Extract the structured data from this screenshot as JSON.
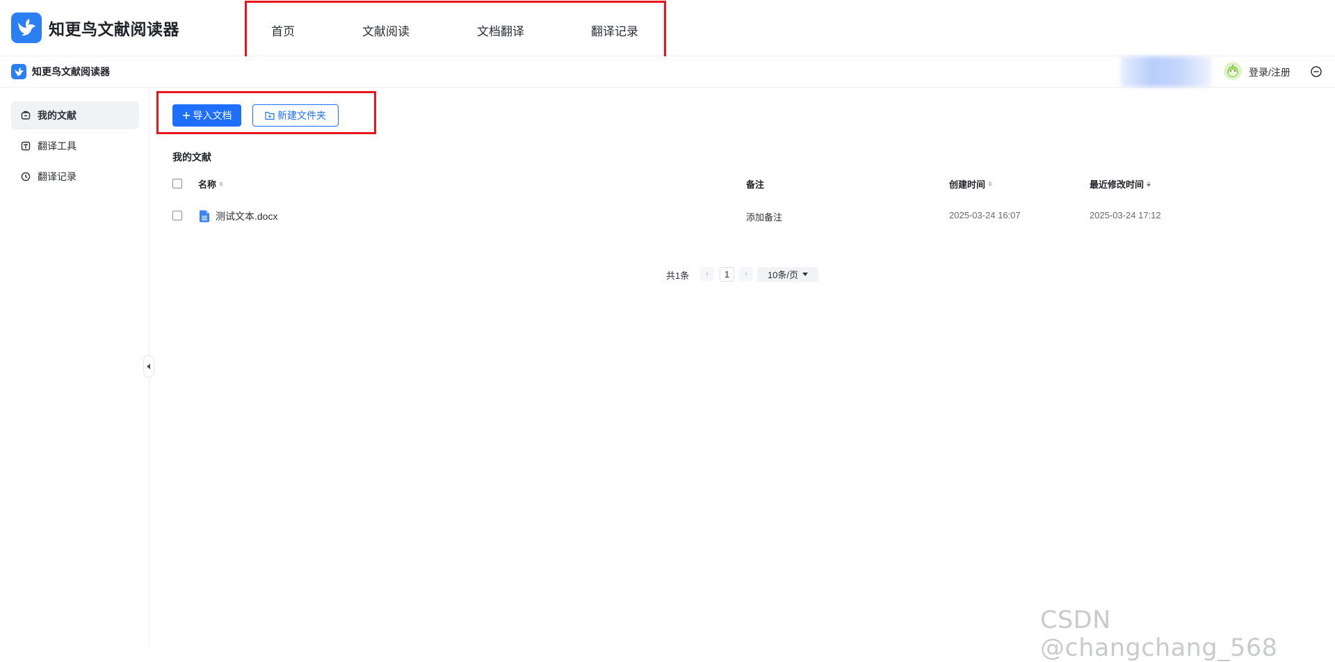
{
  "app": {
    "name": "知更鸟文献阅读器",
    "accent": "#1e6fff",
    "brand_color": "#2b7ff0",
    "highlight_color": "#e8161c"
  },
  "nav": {
    "items": [
      "首页",
      "文献阅读",
      "文档翻译",
      "翻译记录"
    ]
  },
  "subheader": {
    "title": "知更鸟文献阅读器",
    "login_label": "登录/注册"
  },
  "sidebar": {
    "items": [
      {
        "label": "我的文献",
        "icon": "folder-icon",
        "active": true
      },
      {
        "label": "翻译工具",
        "icon": "translate-icon",
        "active": false
      },
      {
        "label": "翻译记录",
        "icon": "clock-icon",
        "active": false
      }
    ]
  },
  "toolbar": {
    "import_label": "导入文档",
    "new_folder_label": "新建文件夹"
  },
  "section": {
    "title": "我的文献"
  },
  "table": {
    "columns": [
      "名称",
      "备注",
      "创建时间",
      "最近修改时间"
    ],
    "rows": [
      {
        "name": "测试文本.docx",
        "note": "添加备注",
        "created": "2025-03-24 16:07",
        "modified": "2025-03-24 17:12"
      }
    ]
  },
  "pagination": {
    "total_label": "共1条",
    "current_page": "1",
    "page_size_label": "10条/页",
    "prev": "‹",
    "next": "›"
  },
  "watermark": "CSDN @changchang_568"
}
